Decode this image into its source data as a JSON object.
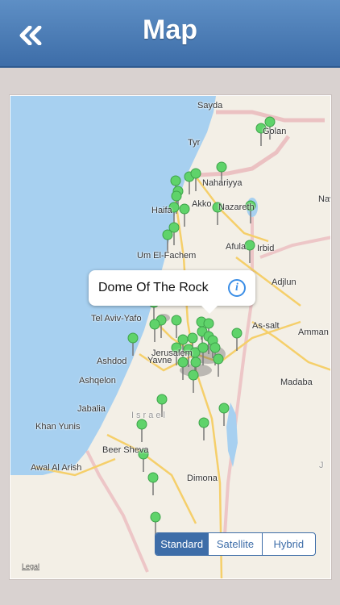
{
  "header": {
    "title": "Map"
  },
  "map": {
    "callout": "Dome Of The Rock",
    "legal": "Legal",
    "places": [
      "Sayda",
      "Tyr",
      "Nahariyya",
      "Akko",
      "Haifa",
      "Nazareth",
      "Afula",
      "Irbid",
      "Um El-Fachem",
      "Adjlun",
      "Tel Aviv-Yafo",
      "As-salt",
      "Amman",
      "Ashdod",
      "Yavne",
      "Jerusalem",
      "Ashqelon",
      "Madaba",
      "Jabalia",
      "Khan Yunis",
      "Beer Sheva",
      "Dimona",
      "Awal Al Arish",
      "Nav",
      "Golan",
      "Israel",
      "J"
    ],
    "map_types": {
      "standard": "Standard",
      "satellite": "Satellite",
      "hybrid": "Hybrid"
    },
    "selected_type": "Standard"
  },
  "colors": {
    "nav": "#4a7db8",
    "pin": "#5fd36a",
    "sea": "#a7d0f0"
  }
}
